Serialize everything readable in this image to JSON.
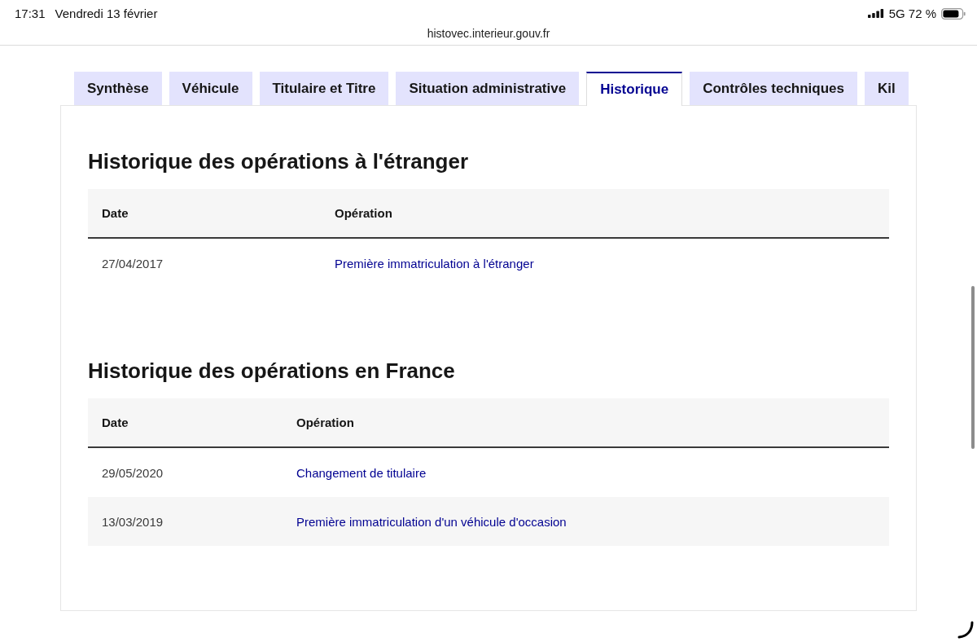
{
  "status_bar": {
    "time": "17:31",
    "date": "Vendredi 13 février",
    "network": "5G",
    "battery": "72 %"
  },
  "address_bar": {
    "url": "histovec.interieur.gouv.fr"
  },
  "tabs": [
    {
      "label": "Synthèse",
      "selected": false
    },
    {
      "label": "Véhicule",
      "selected": false
    },
    {
      "label": "Titulaire et Titre",
      "selected": false
    },
    {
      "label": "Situation administrative",
      "selected": false
    },
    {
      "label": "Historique",
      "selected": true
    },
    {
      "label": "Contrôles techniques",
      "selected": false
    },
    {
      "label": "Kil",
      "selected": false
    }
  ],
  "sections": [
    {
      "title": "Historique des opérations à l'étranger",
      "table": {
        "columns": [
          "Date",
          "Opération"
        ],
        "rows": [
          {
            "date": "27/04/2017",
            "operation": "Première immatriculation à l'étranger"
          }
        ]
      }
    },
    {
      "title": "Historique des opérations en France",
      "table": {
        "columns": [
          "Date",
          "Opération"
        ],
        "rows": [
          {
            "date": "29/05/2020",
            "operation": "Changement de titulaire"
          },
          {
            "date": "13/03/2019",
            "operation": "Première immatriculation d'un véhicule d'occasion"
          }
        ]
      }
    }
  ]
}
